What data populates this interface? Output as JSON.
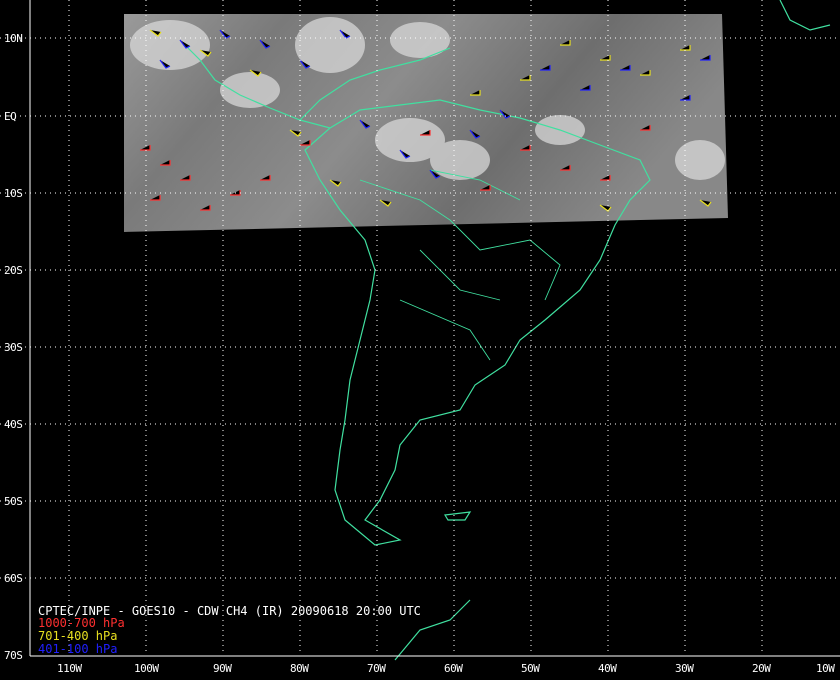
{
  "caption": "CPTEC/INPE - GOES10 - CDW CH4 (IR) 20090618 20:00 UTC",
  "legend": [
    {
      "label": "1000-700 hPa",
      "color": "#ff3030"
    },
    {
      "label": "701-400 hPa",
      "color": "#e8e020"
    },
    {
      "label": "401-100 hPa",
      "color": "#2020ff"
    }
  ],
  "lat_labels": [
    "10N",
    "EQ",
    "10S",
    "20S",
    "30S",
    "40S",
    "50S",
    "60S",
    "70S"
  ],
  "lon_labels": [
    "110W",
    "100W",
    "90W",
    "80W",
    "70W",
    "60W",
    "50W",
    "40W",
    "30W",
    "20W",
    "10W"
  ],
  "colors": {
    "background": "#000000",
    "coastline": "#40e0a0",
    "grid": "#ffffff",
    "text": "#ffffff"
  }
}
